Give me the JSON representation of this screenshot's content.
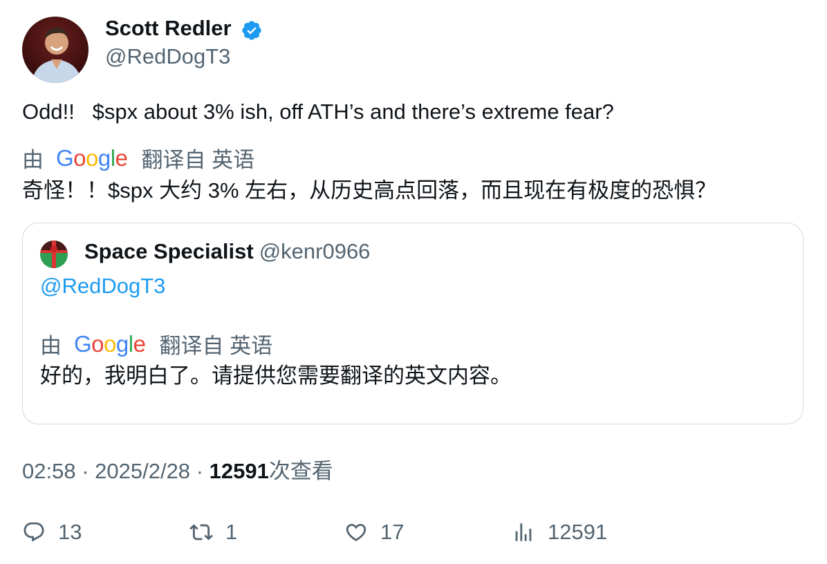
{
  "author": {
    "name": "Scott Redler",
    "handle": "@RedDogT3",
    "verified": true
  },
  "tweet": {
    "text": "Odd!!   $spx about 3% ish, off ATH’s and there’s extreme fear?",
    "translation": {
      "by_label": "由",
      "provider": "Google",
      "from_label": "翻译自 英语",
      "text": "奇怪！！$spx 大约 3% 左右，从历史高点回落，而且现在有极度的恐惧？"
    }
  },
  "quoted_tweet": {
    "name": "Space Specialist",
    "handle": "@kenr0966",
    "text": "@RedDogT3",
    "translation": {
      "by_label": "由",
      "provider": "Google",
      "from_label": "翻译自 英语",
      "text": "好的，我明白了。请提供您需要翻译的英文内容。"
    }
  },
  "meta": {
    "time": "02:58",
    "date": "2025/2/28",
    "views": "12591",
    "views_suffix": "次查看"
  },
  "actions": {
    "replies": "13",
    "reposts": "1",
    "likes": "17",
    "views": "12591"
  },
  "colors": {
    "accent": "#1d9bf0",
    "muted": "#536471",
    "text": "#0f1419",
    "border": "#cfd9de"
  },
  "icons": [
    "verified-badge-icon",
    "reply-icon",
    "repost-icon",
    "like-icon",
    "views-icon"
  ]
}
